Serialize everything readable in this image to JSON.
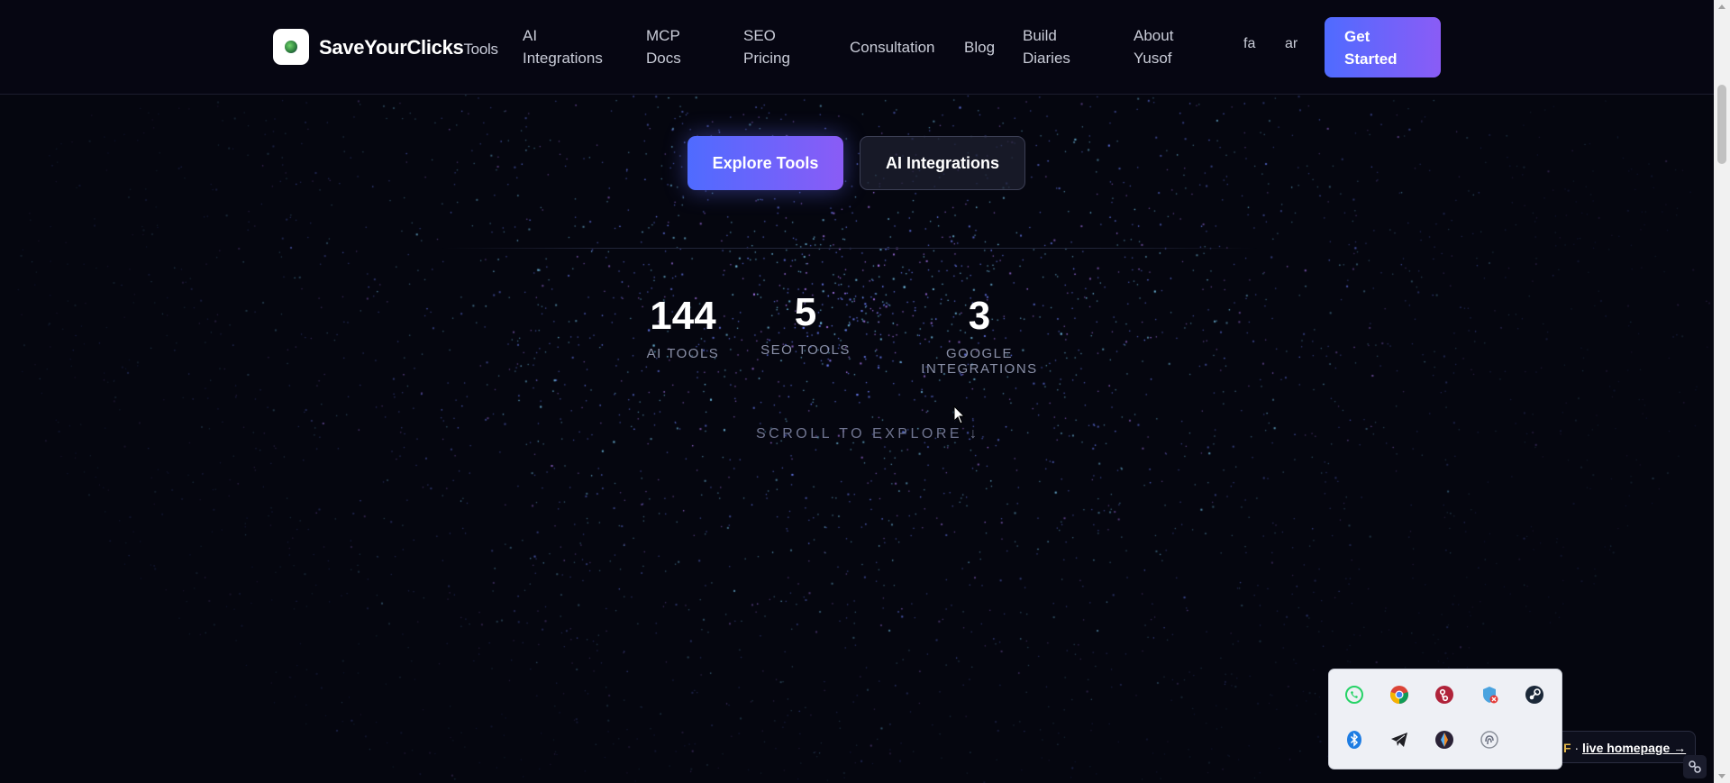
{
  "header": {
    "brand": "SaveYourClicks",
    "brand_suffix": "Tools",
    "nav": [
      {
        "line1": "AI",
        "line2": "Integrations"
      },
      {
        "line1": "MCP",
        "line2": "Docs"
      },
      {
        "line1": "SEO",
        "line2": "Pricing"
      },
      {
        "line1": "Consultation",
        "line2": ""
      },
      {
        "line1": "Blog",
        "line2": ""
      },
      {
        "line1": "Build",
        "line2": "Diaries"
      },
      {
        "line1": "About",
        "line2": "Yusof"
      }
    ],
    "languages": [
      "fa",
      "ar"
    ],
    "cta": {
      "line1": "Get",
      "line2": "Started"
    }
  },
  "hero": {
    "primary_button": "Explore Tools",
    "secondary_button": "AI Integrations",
    "stats": [
      {
        "value": "144",
        "label": "AI TOOLS"
      },
      {
        "value": "5",
        "label": "SEO TOOLS"
      },
      {
        "value": "3",
        "label": "GOOGLE INTEGRATIONS"
      }
    ],
    "scroll_hint": "SCROLL TO EXPLORE ↓"
  },
  "live_bar": {
    "prefix": "F",
    "separator": " · ",
    "link": "live homepage →"
  },
  "tray": {
    "icons": [
      "whatsapp-icon",
      "chrome-icon",
      "git-icon",
      "shield-alert-icon",
      "steam-icon",
      "bluetooth-icon",
      "telegram-icon",
      "color-app-icon",
      "fingerprint-icon"
    ]
  },
  "colors": {
    "background": "#05060f",
    "accent_start": "#4f6bff",
    "accent_end": "#8a5cf6"
  }
}
